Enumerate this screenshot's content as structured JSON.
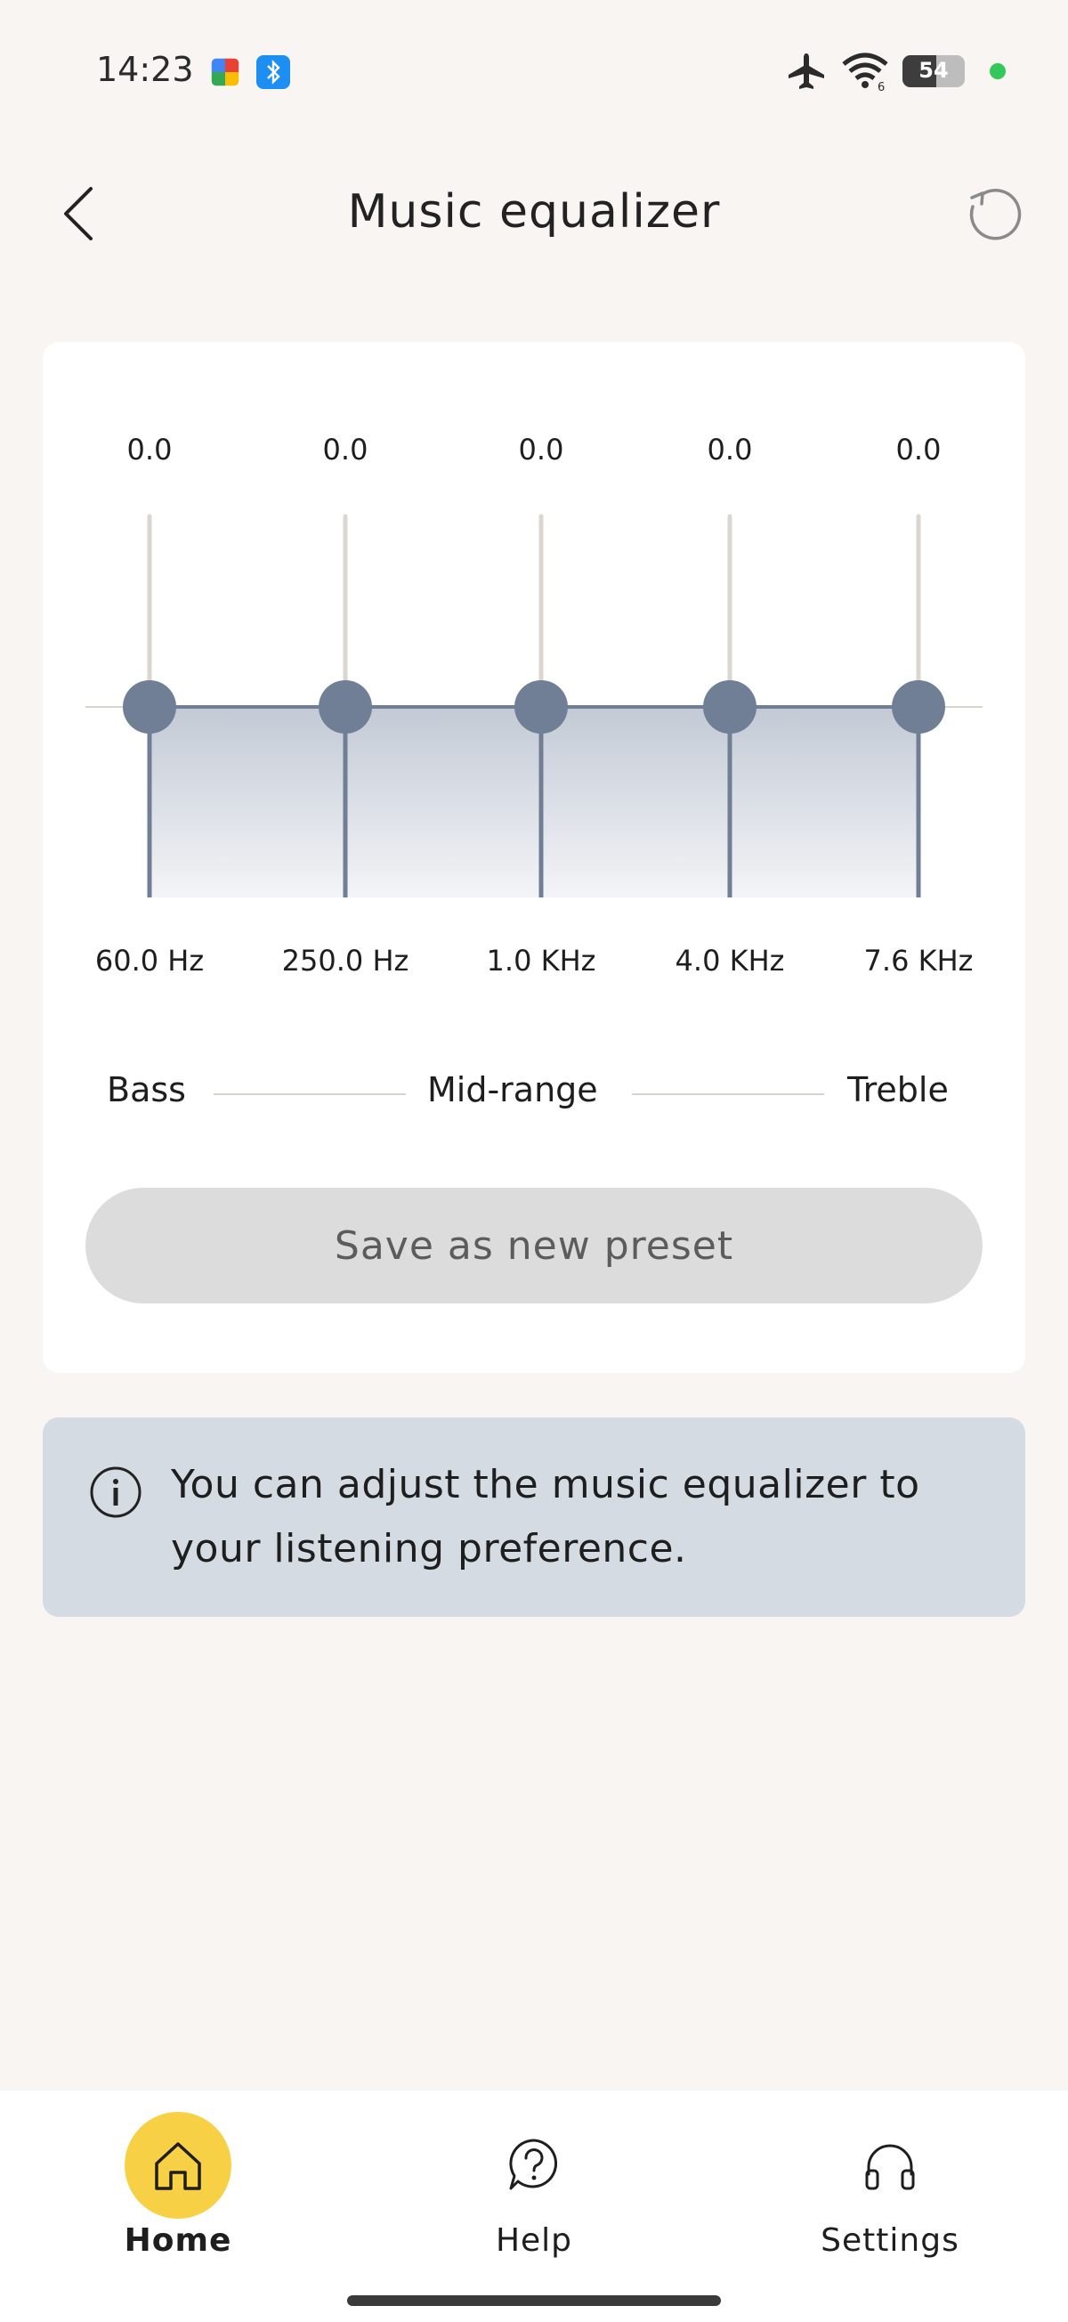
{
  "status_bar": {
    "time": "14:23",
    "battery": "54",
    "battery_level": 0.54,
    "icons": [
      "puzzle-app-icon",
      "bluetooth-app-icon",
      "airplane-icon",
      "wifi-icon",
      "battery-icon"
    ]
  },
  "header": {
    "title": "Music equalizer",
    "back_icon": "chevron-left-icon",
    "reset_icon": "reset-icon"
  },
  "equalizer": {
    "bands": [
      {
        "value": "0.0",
        "freq": "60.0 Hz",
        "gain": 0.0
      },
      {
        "value": "0.0",
        "freq": "250.0 Hz",
        "gain": 0.0
      },
      {
        "value": "0.0",
        "freq": "1.0 KHz",
        "gain": 0.0
      },
      {
        "value": "0.0",
        "freq": "4.0 KHz",
        "gain": 0.0
      },
      {
        "value": "0.0",
        "freq": "7.6 KHz",
        "gain": 0.0
      }
    ],
    "ranges": {
      "bass": "Bass",
      "mid": "Mid-range",
      "treble": "Treble"
    },
    "save_label": "Save as new preset",
    "colors": {
      "knob": "#717f96",
      "track": "#dcd6d1",
      "fill": "#c9d0da"
    }
  },
  "info": {
    "text": "You can adjust the music equalizer to your listening preference.",
    "icon": "info-icon"
  },
  "nav": {
    "items": [
      {
        "label": "Home",
        "icon": "home-icon",
        "active": true
      },
      {
        "label": "Help",
        "icon": "help-bubble-icon",
        "active": false
      },
      {
        "label": "Settings",
        "icon": "headphones-icon",
        "active": false
      }
    ],
    "accent": "#f7d046"
  }
}
